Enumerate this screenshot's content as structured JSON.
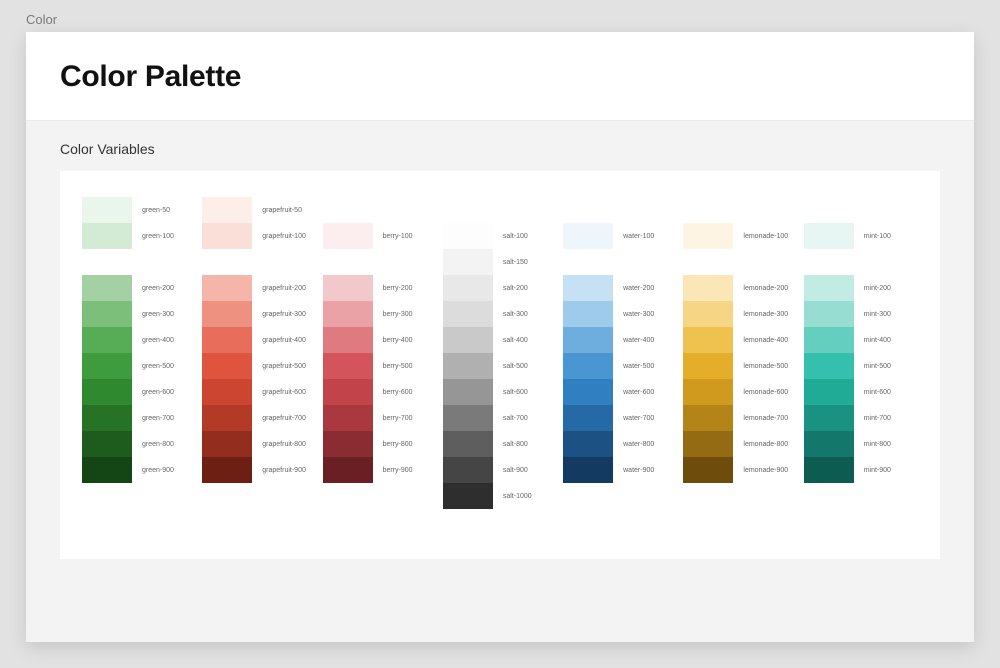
{
  "breadcrumb": "Color",
  "page_title": "Color Palette",
  "section_title": "Color Variables",
  "families": [
    {
      "name": "green",
      "swatches": [
        {
          "step": "50",
          "hex": "#eaf5ec"
        },
        {
          "step": "100",
          "hex": "#d3ead4"
        },
        {
          "step": "spacer"
        },
        {
          "step": "200",
          "hex": "#a3d1a3"
        },
        {
          "step": "300",
          "hex": "#7cbf7a"
        },
        {
          "step": "400",
          "hex": "#56ad55"
        },
        {
          "step": "500",
          "hex": "#3e9b3e"
        },
        {
          "step": "600",
          "hex": "#2f8a2f"
        },
        {
          "step": "700",
          "hex": "#267326"
        },
        {
          "step": "800",
          "hex": "#1d5c1d"
        },
        {
          "step": "900",
          "hex": "#144514"
        }
      ]
    },
    {
      "name": "grapefruit",
      "swatches": [
        {
          "step": "50",
          "hex": "#fdeeea"
        },
        {
          "step": "100",
          "hex": "#fadfd8"
        },
        {
          "step": "spacer"
        },
        {
          "step": "200",
          "hex": "#f5b5a8"
        },
        {
          "step": "300",
          "hex": "#ef9181"
        },
        {
          "step": "400",
          "hex": "#e86e5b"
        },
        {
          "step": "500",
          "hex": "#df543e"
        },
        {
          "step": "600",
          "hex": "#cb4530"
        },
        {
          "step": "700",
          "hex": "#b33a27"
        },
        {
          "step": "800",
          "hex": "#932d1d"
        },
        {
          "step": "900",
          "hex": "#6e1f13"
        }
      ]
    },
    {
      "name": "berry",
      "swatches": [
        {
          "step": "blank"
        },
        {
          "step": "100",
          "hex": "#fceeef"
        },
        {
          "step": "spacer"
        },
        {
          "step": "200",
          "hex": "#f3c8cb"
        },
        {
          "step": "300",
          "hex": "#eaa2a7"
        },
        {
          "step": "400",
          "hex": "#df7a80"
        },
        {
          "step": "500",
          "hex": "#d4545b"
        },
        {
          "step": "600",
          "hex": "#c2434a"
        },
        {
          "step": "700",
          "hex": "#a9383f"
        },
        {
          "step": "800",
          "hex": "#8b2c32"
        },
        {
          "step": "900",
          "hex": "#6a1f25"
        }
      ]
    },
    {
      "name": "salt",
      "swatches": [
        {
          "step": "blank"
        },
        {
          "step": "100",
          "hex": "#fdfdfd"
        },
        {
          "step": "150",
          "hex": "#f3f3f3"
        },
        {
          "step": "200",
          "hex": "#e8e8e8"
        },
        {
          "step": "300",
          "hex": "#dcdcdc"
        },
        {
          "step": "400",
          "hex": "#c9c9c9"
        },
        {
          "step": "500",
          "hex": "#b0b0b0"
        },
        {
          "step": "600",
          "hex": "#969696"
        },
        {
          "step": "700",
          "hex": "#7a7a7a"
        },
        {
          "step": "800",
          "hex": "#5e5e5e"
        },
        {
          "step": "900",
          "hex": "#454545"
        },
        {
          "step": "1000",
          "hex": "#2e2e2e"
        }
      ]
    },
    {
      "name": "water",
      "swatches": [
        {
          "step": "blank"
        },
        {
          "step": "100",
          "hex": "#eef6fc"
        },
        {
          "step": "spacer"
        },
        {
          "step": "200",
          "hex": "#c6e1f4"
        },
        {
          "step": "300",
          "hex": "#9ecaec"
        },
        {
          "step": "400",
          "hex": "#6daedf"
        },
        {
          "step": "500",
          "hex": "#4a96d3"
        },
        {
          "step": "600",
          "hex": "#2f7fc1"
        },
        {
          "step": "700",
          "hex": "#2569a6"
        },
        {
          "step": "800",
          "hex": "#1c5183"
        },
        {
          "step": "900",
          "hex": "#133a61"
        }
      ]
    },
    {
      "name": "lemonade",
      "swatches": [
        {
          "step": "blank"
        },
        {
          "step": "100",
          "hex": "#fdf4e2"
        },
        {
          "step": "spacer"
        },
        {
          "step": "200",
          "hex": "#fbe6b8"
        },
        {
          "step": "300",
          "hex": "#f6d584"
        },
        {
          "step": "400",
          "hex": "#efc24f"
        },
        {
          "step": "500",
          "hex": "#e4ae2a"
        },
        {
          "step": "600",
          "hex": "#cf9a1e"
        },
        {
          "step": "700",
          "hex": "#b58418"
        },
        {
          "step": "800",
          "hex": "#946a12"
        },
        {
          "step": "900",
          "hex": "#6e4d0c"
        }
      ]
    },
    {
      "name": "mint",
      "swatches": [
        {
          "step": "blank"
        },
        {
          "step": "100",
          "hex": "#e8f6f3"
        },
        {
          "step": "spacer"
        },
        {
          "step": "200",
          "hex": "#c2ebe3"
        },
        {
          "step": "300",
          "hex": "#97ddd1"
        },
        {
          "step": "400",
          "hex": "#64cfbf"
        },
        {
          "step": "500",
          "hex": "#34c0ac"
        },
        {
          "step": "600",
          "hex": "#20ab97"
        },
        {
          "step": "700",
          "hex": "#199282"
        },
        {
          "step": "800",
          "hex": "#13786b"
        },
        {
          "step": "900",
          "hex": "#0d5c52"
        }
      ]
    }
  ]
}
